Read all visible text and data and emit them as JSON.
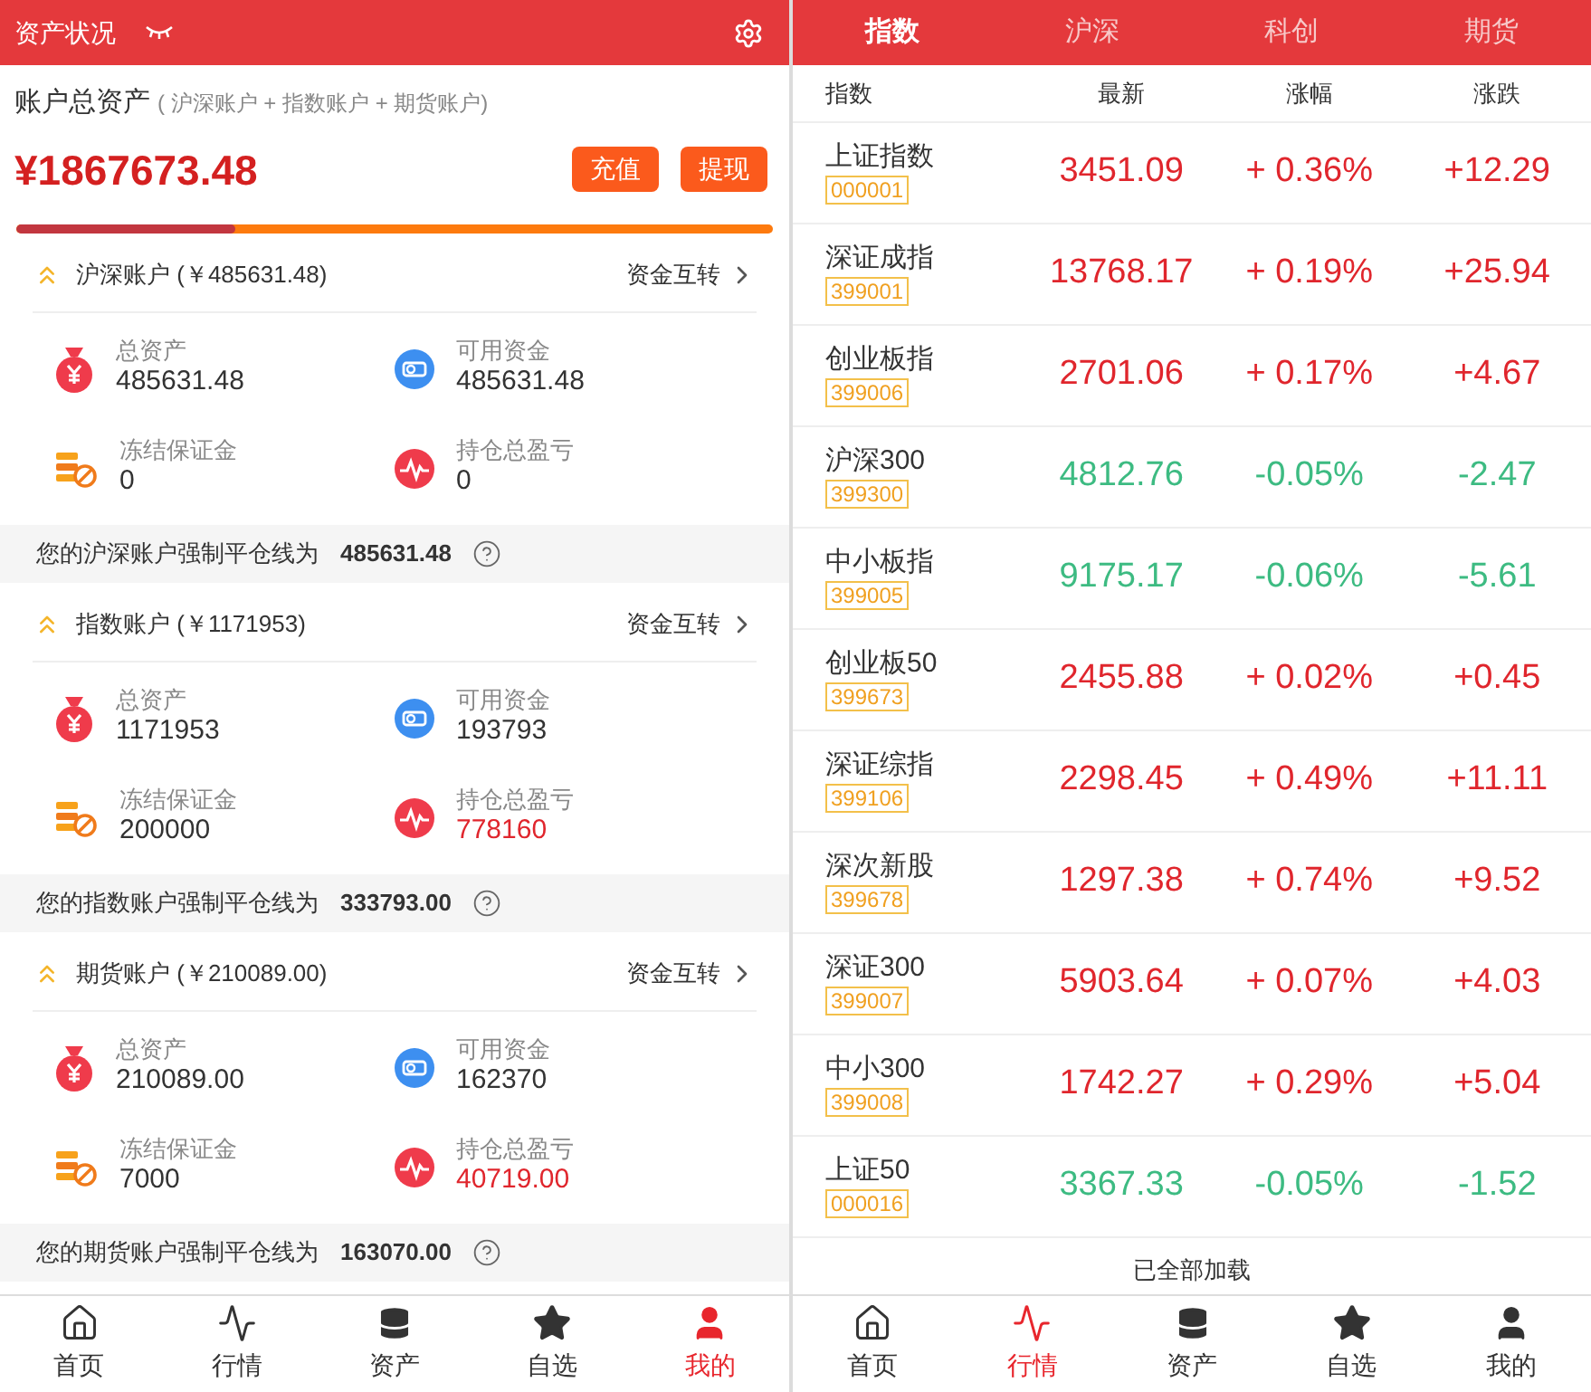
{
  "asset_screen": {
    "header": {
      "title": "资产状况"
    },
    "summary": {
      "label": "账户总资产",
      "note": "( 沪深账户 + 指数账户 + 期货账户)",
      "amount": "¥1867673.48",
      "buttons": [
        "充值",
        "提现"
      ],
      "progress": {
        "level": 0.29
      }
    },
    "accounts": [
      {
        "title": "沪深账户 (￥485631.48)",
        "transfer": "资金互转",
        "metrics": [
          {
            "kind": "total",
            "label": "总资产",
            "value": "485631.48",
            "highlighted": false
          },
          {
            "kind": "available",
            "label": "可用资金",
            "value": "485631.48",
            "highlighted": false
          },
          {
            "kind": "frozen",
            "label": "冻结保证金",
            "value": "0",
            "highlighted": false
          },
          {
            "kind": "pnl",
            "label": "持仓总盈亏",
            "value": "0",
            "highlighted": false
          }
        ],
        "liquidation": {
          "label": "您的沪深账户强制平仓线为",
          "value": "485631.48"
        }
      },
      {
        "title": "指数账户 (￥1171953)",
        "transfer": "资金互转",
        "metrics": [
          {
            "kind": "total",
            "label": "总资产",
            "value": "1171953",
            "highlighted": false
          },
          {
            "kind": "available",
            "label": "可用资金",
            "value": "193793",
            "highlighted": false
          },
          {
            "kind": "frozen",
            "label": "冻结保证金",
            "value": "200000",
            "highlighted": false
          },
          {
            "kind": "pnl",
            "label": "持仓总盈亏",
            "value": "778160",
            "highlighted": true
          }
        ],
        "liquidation": {
          "label": "您的指数账户强制平仓线为",
          "value": "333793.00"
        }
      },
      {
        "title": "期货账户 (￥210089.00)",
        "transfer": "资金互转",
        "metrics": [
          {
            "kind": "total",
            "label": "总资产",
            "value": "210089.00",
            "highlighted": false
          },
          {
            "kind": "available",
            "label": "可用资金",
            "value": "162370",
            "highlighted": false
          },
          {
            "kind": "frozen",
            "label": "冻结保证金",
            "value": "7000",
            "highlighted": false
          },
          {
            "kind": "pnl",
            "label": "持仓总盈亏",
            "value": "40719.00",
            "highlighted": true
          }
        ],
        "liquidation": {
          "label": "您的期货账户强制平仓线为",
          "value": "163070.00"
        }
      }
    ],
    "nav": [
      {
        "kind": "home",
        "label": "首页",
        "selected": false
      },
      {
        "kind": "pulse",
        "label": "行情",
        "selected": false
      },
      {
        "kind": "coins",
        "label": "资产",
        "selected": false
      },
      {
        "kind": "star",
        "label": "自选",
        "selected": false
      },
      {
        "kind": "user",
        "label": "我的",
        "selected": true
      }
    ]
  },
  "market_screen": {
    "tabs": [
      {
        "label": "指数",
        "selected": true
      },
      {
        "label": "沪深",
        "selected": false
      },
      {
        "label": "科创",
        "selected": false
      },
      {
        "label": "期货",
        "selected": false
      }
    ],
    "columns": [
      "指数",
      "最新",
      "涨幅",
      "涨跌"
    ],
    "rows": [
      {
        "name": "上证指数",
        "code": "000001",
        "price": "3451.09",
        "change_pct": "+ 0.36%",
        "change": "+12.29",
        "rising": true
      },
      {
        "name": "深证成指",
        "code": "399001",
        "price": "13768.17",
        "change_pct": "+ 0.19%",
        "change": "+25.94",
        "rising": true
      },
      {
        "name": "创业板指",
        "code": "399006",
        "price": "2701.06",
        "change_pct": "+ 0.17%",
        "change": "+4.67",
        "rising": true
      },
      {
        "name": "沪深300",
        "code": "399300",
        "price": "4812.76",
        "change_pct": "-0.05%",
        "change": "-2.47",
        "rising": false
      },
      {
        "name": "中小板指",
        "code": "399005",
        "price": "9175.17",
        "change_pct": "-0.06%",
        "change": "-5.61",
        "rising": false
      },
      {
        "name": "创业板50",
        "code": "399673",
        "price": "2455.88",
        "change_pct": "+ 0.02%",
        "change": "+0.45",
        "rising": true
      },
      {
        "name": "深证综指",
        "code": "399106",
        "price": "2298.45",
        "change_pct": "+ 0.49%",
        "change": "+11.11",
        "rising": true
      },
      {
        "name": "深次新股",
        "code": "399678",
        "price": "1297.38",
        "change_pct": "+ 0.74%",
        "change": "+9.52",
        "rising": true
      },
      {
        "name": "深证300",
        "code": "399007",
        "price": "5903.64",
        "change_pct": "+ 0.07%",
        "change": "+4.03",
        "rising": true
      },
      {
        "name": "中小300",
        "code": "399008",
        "price": "1742.27",
        "change_pct": "+ 0.29%",
        "change": "+5.04",
        "rising": true
      },
      {
        "name": "上证50",
        "code": "000016",
        "price": "3367.33",
        "change_pct": "-0.05%",
        "change": "-1.52",
        "rising": false
      }
    ],
    "footer": "已全部加载",
    "nav": [
      {
        "kind": "home",
        "label": "首页",
        "selected": false
      },
      {
        "kind": "pulse",
        "label": "行情",
        "selected": true
      },
      {
        "kind": "coins",
        "label": "资产",
        "selected": false
      },
      {
        "kind": "star",
        "label": "自选",
        "selected": false
      },
      {
        "kind": "user",
        "label": "我的",
        "selected": false
      }
    ]
  }
}
